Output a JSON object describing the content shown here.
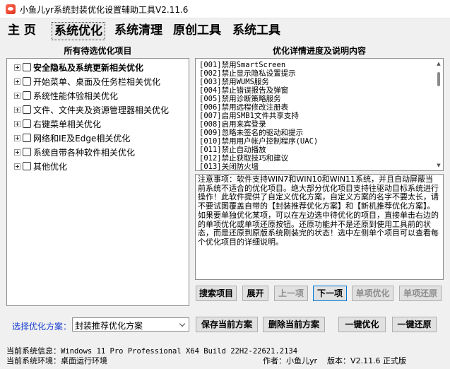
{
  "window": {
    "title": "小鱼儿yr系统封装优化设置辅助工具V2.11.6"
  },
  "menu": {
    "tabs": [
      {
        "label": "主 页"
      },
      {
        "label": "系统优化"
      },
      {
        "label": "系统清理"
      },
      {
        "label": "原创工具"
      },
      {
        "label": "系统工具"
      }
    ]
  },
  "left_panel": {
    "title": "所有待选优化项目",
    "items": [
      {
        "label": "安全隐私及系统更新相关优化"
      },
      {
        "label": "开始菜单、桌面及任务栏相关优化"
      },
      {
        "label": "系统性能体验相关优化"
      },
      {
        "label": "文件、文件夹及资源管理器相关优化"
      },
      {
        "label": "右键菜单相关优化"
      },
      {
        "label": "网络和IE及Edge相关优化"
      },
      {
        "label": "系统自带各种软件相关优化"
      },
      {
        "label": "其他优化"
      }
    ]
  },
  "right_panel": {
    "title": "优化详情进度及说明内容",
    "items": [
      "[001]禁用SmartScreen",
      "[002]禁止显示隐私设置提示",
      "[003]禁用WUMS服务",
      "[004]禁止错误报告及弹窗",
      "[005]禁用诊断策略服务",
      "[006]禁用远程修改注册表",
      "[007]启用SMB1文件共享支持",
      "[008]启用来宾登录",
      "[009]忽略未签名的驱动和提示",
      "[010]禁用用户帐户控制程序(UAC)",
      "[011]禁止自动播放",
      "[012]禁止获取技巧和建议",
      "[013]关闭防火墙"
    ],
    "notes": "注意事项：软件支持WIN7和WIN10和WIN11系统，并且自动屏蔽当前系统不适合的优化项目。绝大部分优化项目支持往驱动目标系统进行操作！此软件提供了自定义优化方案，自定义方案的名字不要太长，请不要试图覆盖自带的【封装推荐优化方案】和【新机推荐优化方案】。如果要单独优化某项，可以在左边选中待优化的项目，直接单击右边的的单项优化或单项还原按钮。还原功能并不是还原到使用工具前的状态，而是还原到原版系统刚装完的状态！选中左侧单个项目可以查看每个优化项目的详细说明。"
  },
  "nav_buttons": {
    "search": "搜索项目",
    "expand": "展开",
    "prev": "上一项",
    "next": "下一项",
    "single_optimize": "单项优化",
    "single_restore": "单项还原"
  },
  "scheme": {
    "label": "选择优化方案：",
    "selected": "封装推荐优化方案",
    "save": "保存当前方案",
    "delete": "删除当前方案",
    "one_click_optimize": "一键优化",
    "one_click_restore": "一键还原"
  },
  "status": {
    "sysinfo_label": "当前系统信息：",
    "sysinfo_value": "Windows 11 Pro Professional X64 Build 22H2-22621.2134",
    "env_label": "当前系统环境：",
    "env_value": "桌面运行环境",
    "author": "作者：小鱼儿yr",
    "version": "版本：V2.11.6 正式版"
  }
}
